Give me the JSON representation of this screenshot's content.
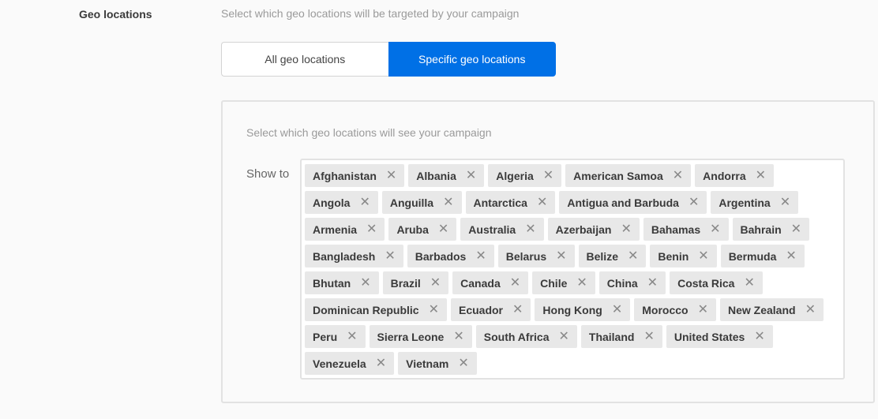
{
  "section": {
    "label": "Geo locations",
    "description": "Select which geo locations will be targeted by your campaign"
  },
  "toggle": {
    "options": [
      {
        "label": "All geo locations",
        "selected": false
      },
      {
        "label": "Specific geo locations",
        "selected": true
      }
    ],
    "accent_color": "#0070e6"
  },
  "panel": {
    "description": "Select which geo locations will see your campaign",
    "show_to_label": "Show to",
    "remove_icon": "close-icon",
    "selected_locations": [
      "Afghanistan",
      "Albania",
      "Algeria",
      "American Samoa",
      "Andorra",
      "Angola",
      "Anguilla",
      "Antarctica",
      "Antigua and Barbuda",
      "Argentina",
      "Armenia",
      "Aruba",
      "Australia",
      "Azerbaijan",
      "Bahamas",
      "Bahrain",
      "Bangladesh",
      "Barbados",
      "Belarus",
      "Belize",
      "Benin",
      "Bermuda",
      "Bhutan",
      "Brazil",
      "Canada",
      "Chile",
      "China",
      "Costa Rica",
      "Dominican Republic",
      "Ecuador",
      "Hong Kong",
      "Morocco",
      "New Zealand",
      "Peru",
      "Sierra Leone",
      "South Africa",
      "Thailand",
      "United States",
      "Venezuela",
      "Vietnam"
    ]
  }
}
